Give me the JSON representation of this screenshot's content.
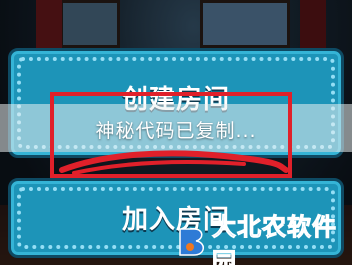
{
  "menu": {
    "create_room_label": "创建房间",
    "join_room_label": "加入房间"
  },
  "toast": {
    "message": "神秘代码已复制..."
  },
  "annotation": {
    "highlight_color": "#e0202a"
  },
  "watermark": {
    "text": "大北农软件园",
    "brand_color": "#2e7bd6"
  },
  "colors": {
    "button_fill": "#1d94b8",
    "button_border": "#0e4a63"
  }
}
